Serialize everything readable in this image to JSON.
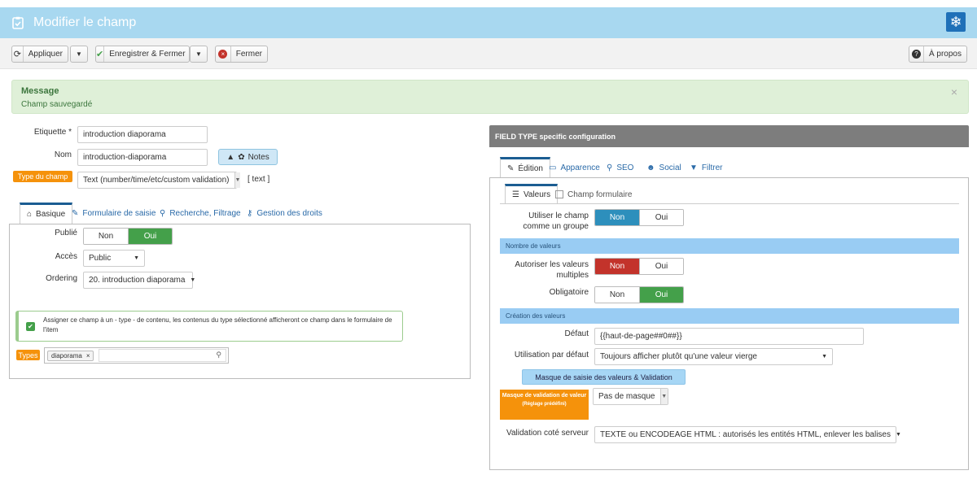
{
  "header": {
    "title": "Modifier le champ"
  },
  "toolbar": {
    "apply_label": "Appliquer",
    "save_close_label": "Enregistrer & Fermer",
    "close_label": "Fermer",
    "about_label": "À propos"
  },
  "message": {
    "heading": "Message",
    "text": "Champ sauvegardé",
    "close": "×"
  },
  "left_form": {
    "label_label": "Etiquette *",
    "label_value": "introduction diaporama",
    "name_label": "Nom",
    "name_value": "introduction-diaporama",
    "notes_label": "Notes",
    "field_type_badge": "Type du champ",
    "field_type_value": "Text (number/time/etc/custom validation)",
    "field_type_code": "[ text ]"
  },
  "left_tabs": [
    "Basique",
    "Formulaire de saisie",
    "Recherche, Filtrage",
    "Gestion des droits"
  ],
  "basic": {
    "published_label": "Publié",
    "published_options": [
      "Non",
      "Oui"
    ],
    "published_value": "Oui",
    "access_label": "Accès",
    "access_value": "Public",
    "ordering_label": "Ordering",
    "ordering_value": "20. introduction diaporama",
    "assign_text": "Assigner ce champ à un - type - de contenu, les contenus du type sélectionné afficheront ce champ dans le formulaire de l'item",
    "types_badge": "Types",
    "types_tag": "diaporama"
  },
  "right": {
    "header": "FIELD TYPE specific configuration",
    "tabs": [
      "Édition",
      "Apparence",
      "SEO",
      "Social",
      "Filtrer"
    ],
    "subtabs": [
      "Valeurs",
      "Champ formulaire"
    ],
    "group_label": "Utiliser le champ comme un groupe",
    "toggle_options": [
      "Non",
      "Oui"
    ],
    "group_value": "Non",
    "section_count": "Nombre de valeurs",
    "multi_label": "Autoriser les valeurs multiples",
    "multi_value": "Non",
    "required_label": "Obligatoire",
    "required_value": "Oui",
    "section_creation": "Création des valeurs",
    "default_label": "Défaut",
    "default_value": "{{haut-de-page##0##}}",
    "usage_label": "Utilisation par défaut",
    "usage_value": "Toujours afficher plutôt qu'une valeur vierge",
    "mask_button": "Masque de saisie des valeurs & Validation",
    "mask_badge_line1": "Masque de validation de valeur",
    "mask_badge_line2": "(Réglage prédéfini)",
    "mask_value": "Pas de masque",
    "server_label": "Validation coté serveur",
    "server_value": "TEXTE ou ENCODEAGE HTML : autorisés les entités HTML, enlever les balises"
  },
  "colors": {
    "header_bg": "#a8d8f0",
    "success_bg": "#dff0d8",
    "orange": "#f5920b",
    "green": "#44a04a",
    "blue": "#2d8fbc",
    "red": "#c3332b"
  }
}
